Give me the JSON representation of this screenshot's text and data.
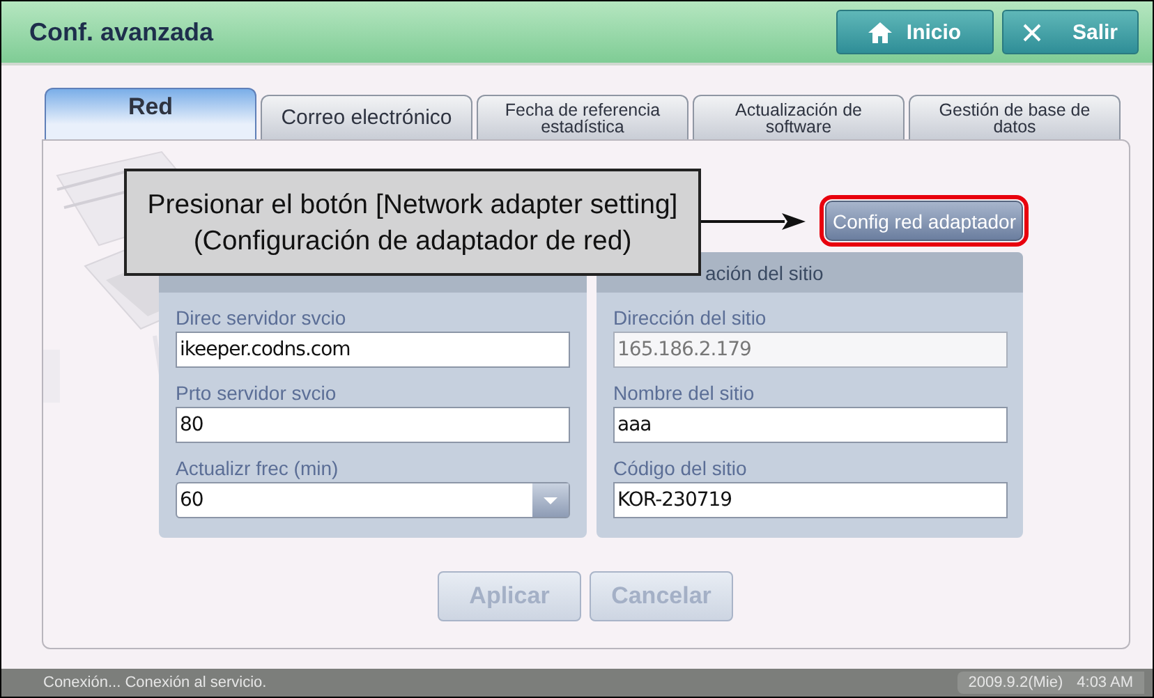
{
  "window": {
    "title": "Conf. avanzada"
  },
  "header_buttons": [
    {
      "label": "Inicio",
      "kind": "home"
    },
    {
      "label": "Salir",
      "kind": "close"
    }
  ],
  "tabs": [
    {
      "label": "Red",
      "selected": true
    },
    {
      "label": "Correo electrónico",
      "selected": false
    },
    {
      "label": "Fecha de referencia estadística",
      "selected": false
    },
    {
      "label": "Actualización de software",
      "selected": false
    },
    {
      "label": "Gestión de base de datos",
      "selected": false
    }
  ],
  "callout": {
    "lines": [
      "Presionar el botón [Network adapter setting]",
      "(Configuración de adaptador de red)"
    ]
  },
  "adapter_button": {
    "label": "Config red adaptador",
    "highlighted": true
  },
  "panels": [
    {
      "fields": [
        {
          "label": "Direc servidor svcio",
          "value": "ikeeper.codns.com",
          "kind": "text",
          "disabled": false
        },
        {
          "label": "Prto servidor svcio",
          "value": "80",
          "kind": "text",
          "disabled": false
        },
        {
          "label": "Actualizr frec (min)",
          "value": "60",
          "kind": "select",
          "disabled": false
        }
      ]
    },
    {
      "title": "ación del sitio",
      "fields": [
        {
          "label": "Dirección del sitio",
          "value": "165.186.2.179",
          "kind": "text",
          "disabled": true
        },
        {
          "label": "Nombre del sitio",
          "value": "aaa",
          "kind": "text",
          "disabled": false
        },
        {
          "label": "Código del sitio",
          "value": "KOR-230719",
          "kind": "text",
          "disabled": false
        }
      ]
    }
  ],
  "actions": [
    {
      "label": "Aplicar",
      "disabled": true
    },
    {
      "label": "Cancelar",
      "disabled": true
    }
  ],
  "status_bar": {
    "message": "Conexión... Conexión al servicio.",
    "date": "2009.9.2(Mie)",
    "time": "4:03 AM"
  }
}
